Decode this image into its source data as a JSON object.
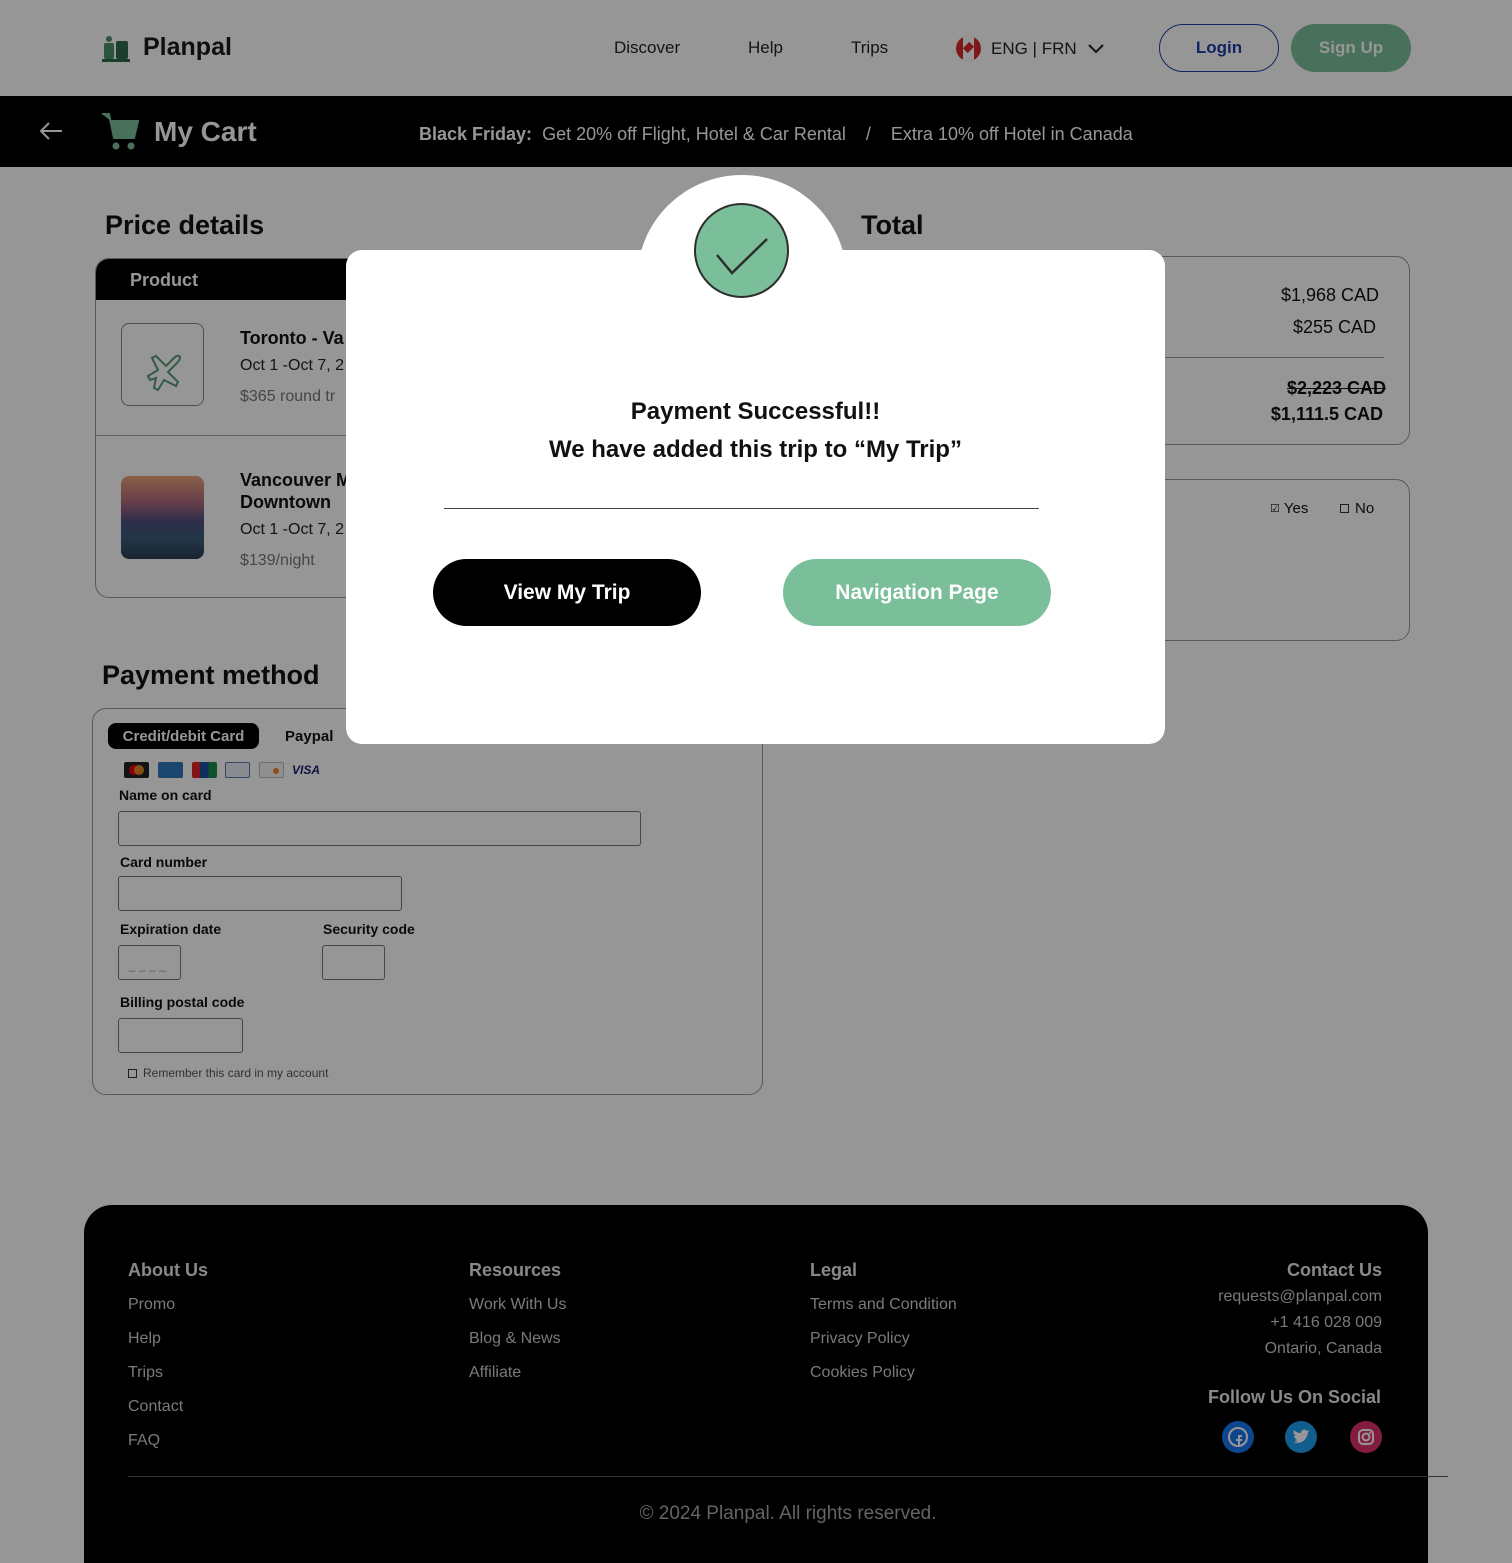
{
  "header": {
    "brand": "Planpal",
    "nav": [
      "Discover",
      "Help",
      "Trips"
    ],
    "language": "ENG | FRN",
    "login": "Login",
    "signup": "Sign Up"
  },
  "cartbar": {
    "title": "My Cart",
    "promo_label": "Black Friday:",
    "promo_text": "Get 20% off Flight, Hotel & Car Rental",
    "promo_sep": "/",
    "promo_extra": "Extra 10% off Hotel in Canada"
  },
  "price_details": {
    "title": "Price details",
    "column": "Product",
    "items": [
      {
        "title": "Toronto - Va",
        "dates": "Oct 1 -Oct 7, 2",
        "price": "$365 round tr"
      },
      {
        "title": "Vancouver M",
        "title2": "Downtown",
        "dates": "Oct 1 -Oct 7, 2",
        "price": "$139/night"
      }
    ]
  },
  "total": {
    "title": "Total",
    "line1": "$1,968 CAD",
    "line2": "$255 CAD",
    "old_total": "$2,223 CAD",
    "new_total": "$1,111.5 CAD",
    "yes": "Yes",
    "no": "No"
  },
  "payment": {
    "title": "Payment method",
    "tab_active": "Credit/debit Card",
    "tab_other": "Paypal",
    "visa": "VISA",
    "name_label": "Name on card",
    "number_label": "Card number",
    "exp_label": "Expiration date",
    "exp_placeholder": "_ _ _ _",
    "sec_label": "Security code",
    "postal_label": "Billing postal code",
    "remember": "Remember this card in my account"
  },
  "footer": {
    "about": {
      "title": "About Us",
      "links": [
        "Promo",
        "Help",
        "Trips",
        "Contact",
        "FAQ"
      ]
    },
    "resources": {
      "title": "Resources",
      "links": [
        "Work With Us",
        "Blog & News",
        "Affiliate"
      ]
    },
    "legal": {
      "title": "Legal",
      "links": [
        "Terms and Condition",
        "Privacy Policy",
        "Cookies Policy"
      ]
    },
    "contact": {
      "title": "Contact Us",
      "email": "requests@planpal.com",
      "phone": "+1 416 028 009",
      "location": "Ontario, Canada"
    },
    "social_title": "Follow Us On Social",
    "copyright": "© 2024 Planpal. All rights reserved."
  },
  "modal": {
    "line1": "Payment Successful!!",
    "line2": "We have added this trip to “My Trip”",
    "view_trip": "View My Trip",
    "navigation": "Navigation Page"
  },
  "colors": {
    "accent_green": "#7bbf9a",
    "login_blue": "#1e3ea8",
    "facebook": "#1877f2",
    "twitter": "#1da1f2",
    "instagram": "#e1306c"
  }
}
